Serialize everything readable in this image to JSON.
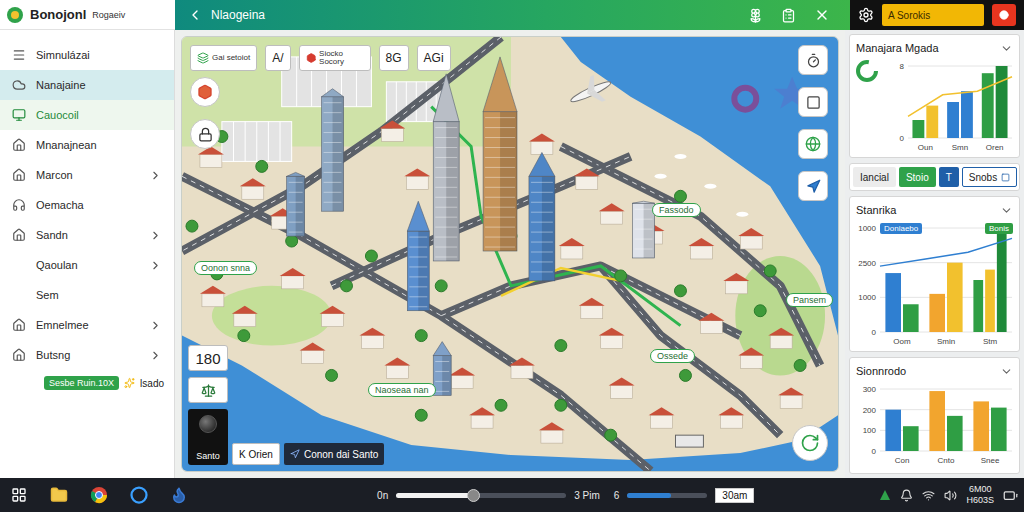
{
  "header": {
    "logo": "Bonojonl",
    "subtitle": "Rogaeiv",
    "title": "Nlaogeina",
    "action": "A Sorokis"
  },
  "sidebar": {
    "items": [
      {
        "label": "Simnulázai",
        "kind": "icon",
        "selected": false,
        "active": false,
        "expandable": false
      },
      {
        "label": "Nanajaine",
        "kind": "icon",
        "selected": true,
        "active": false,
        "expandable": false
      },
      {
        "label": "Cauocoil",
        "kind": "icon",
        "selected": false,
        "active": true,
        "expandable": false
      },
      {
        "label": "Mnanajnean",
        "kind": "icon",
        "selected": false,
        "active": false,
        "expandable": false
      },
      {
        "label": "Marcon",
        "kind": "icon",
        "selected": false,
        "active": false,
        "expandable": true
      },
      {
        "label": "Oemacha",
        "kind": "icon",
        "selected": false,
        "active": false,
        "expandable": false
      },
      {
        "label": "Sandn",
        "kind": "icon",
        "selected": false,
        "active": false,
        "expandable": true
      },
      {
        "label": "Qaoulan",
        "kind": "plain",
        "selected": false,
        "active": false,
        "expandable": true
      },
      {
        "label": "Sem",
        "kind": "plain",
        "selected": false,
        "active": false,
        "expandable": false
      },
      {
        "label": "Emnelmee",
        "kind": "icon",
        "selected": false,
        "active": false,
        "expandable": true
      },
      {
        "label": "Butsng",
        "kind": "icon",
        "selected": false,
        "active": false,
        "expandable": true
      }
    ],
    "badge": "Sesbe Ruin.10X",
    "note": "lsado"
  },
  "map": {
    "tools": [
      "Gai setoiot",
      "A/",
      "Siocko Socory",
      "8G",
      "AGi"
    ],
    "labels": [
      "Oonon snna",
      "Fassodo",
      "Pansem",
      "Ossede",
      "Naoseaa nan"
    ],
    "zoom": "180",
    "bottom": [
      "Santo",
      "K Orien",
      "Conon dai Santo"
    ]
  },
  "panel": {
    "charts": [
      {
        "title": "Manajara Mgada",
        "ticks": [
          "8",
          "0"
        ],
        "max": 10,
        "categories": [
          {
            "label": "Oun",
            "bars": [
              {
                "value": 2.5,
                "color": "#2f9e44"
              },
              {
                "value": 4.5,
                "color": "#f2c12e"
              }
            ]
          },
          {
            "label": "Smn",
            "bars": [
              {
                "value": 5,
                "color": "#2f7fd1"
              },
              {
                "value": 6.5,
                "color": "#2f7fd1"
              }
            ]
          },
          {
            "label": "Oren",
            "bars": [
              {
                "value": 9,
                "color": "#2f9e44"
              },
              {
                "value": 10,
                "color": "#1f8a3a"
              }
            ]
          }
        ],
        "line": {
          "color": "#f2c12e",
          "values": [
            3,
            6,
            6.5,
            8.5
          ]
        },
        "legend": []
      },
      {
        "title": "Stanrika",
        "ticks": [
          "1000",
          "2500",
          "1000",
          "0"
        ],
        "max": 3000,
        "categories": [
          {
            "label": "Oom",
            "bars": [
              {
                "value": 1700,
                "color": "#2f7fd1"
              },
              {
                "value": 800,
                "color": "#2f9e44"
              }
            ]
          },
          {
            "label": "Smin",
            "bars": [
              {
                "value": 1100,
                "color": "#f2a52e"
              },
              {
                "value": 2000,
                "color": "#f2c12e"
              }
            ]
          },
          {
            "label": "Stm",
            "bars": [
              {
                "value": 1500,
                "color": "#2f9e44"
              },
              {
                "value": 1800,
                "color": "#f2c12e"
              },
              {
                "value": 2900,
                "color": "#1f8a3a"
              }
            ]
          }
        ],
        "line": {
          "color": "#2f7fd1",
          "values": [
            1900,
            2100,
            2300,
            2700
          ]
        },
        "legend": [
          {
            "label": "Doniaebo",
            "color": "#2f7fd1"
          },
          {
            "label": "Bonis",
            "color": "#2f9e44"
          }
        ]
      },
      {
        "title": "Sionnrodo",
        "ticks": [
          "300",
          "200",
          "100",
          "0"
        ],
        "max": 300,
        "categories": [
          {
            "label": "Con",
            "bars": [
              {
                "value": 200,
                "color": "#2f7fd1"
              },
              {
                "value": 120,
                "color": "#2f9e44"
              }
            ]
          },
          {
            "label": "Cnto",
            "bars": [
              {
                "value": 290,
                "color": "#f2a52e"
              },
              {
                "value": 170,
                "color": "#2f9e44"
              }
            ]
          },
          {
            "label": "Snee",
            "bars": [
              {
                "value": 240,
                "color": "#f2a52e"
              },
              {
                "value": 210,
                "color": "#2f9e44"
              }
            ]
          }
        ],
        "line": null,
        "legend": []
      }
    ],
    "tabs": [
      {
        "label": "Iancial",
        "kind": "text",
        "selected": false
      },
      {
        "label": "Stoio",
        "kind": "text",
        "selected": true
      },
      {
        "label": "T",
        "kind": "square",
        "selected": false
      },
      {
        "label": "Snobs",
        "kind": "outline",
        "selected": false
      }
    ]
  },
  "taskbar": {
    "sliders": [
      {
        "label": "0n",
        "level": 0.45,
        "reading": "3 Pim"
      },
      {
        "label": "6",
        "level": 0.55,
        "reading": "30am"
      }
    ],
    "clock": {
      "time": "6M00",
      "date": "H603S"
    }
  }
}
